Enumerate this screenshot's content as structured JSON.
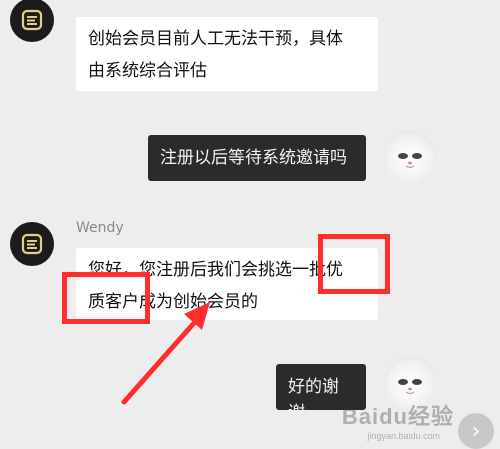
{
  "messages": [
    {
      "from": "bot",
      "text_lines": [
        "创始会员目前人工无法干预，具体",
        "由系统综合评估"
      ]
    },
    {
      "from": "user",
      "text": "注册以后等待系统邀请吗"
    },
    {
      "from": "bot",
      "sender": "Wendy",
      "text_lines": [
        "您好，您注册后我们会挑选一批优",
        "质客户成为创始会员的"
      ]
    },
    {
      "from": "user",
      "text": "好的谢谢"
    }
  ],
  "annotations": {
    "highlight_color": "#ff2d2d",
    "highlighted_phrases": [
      "批优",
      "质客户"
    ]
  },
  "watermark": {
    "text": "Baidu经验",
    "sub": "jingyan.baidu.com"
  },
  "nav": {
    "next_glyph": "›"
  }
}
